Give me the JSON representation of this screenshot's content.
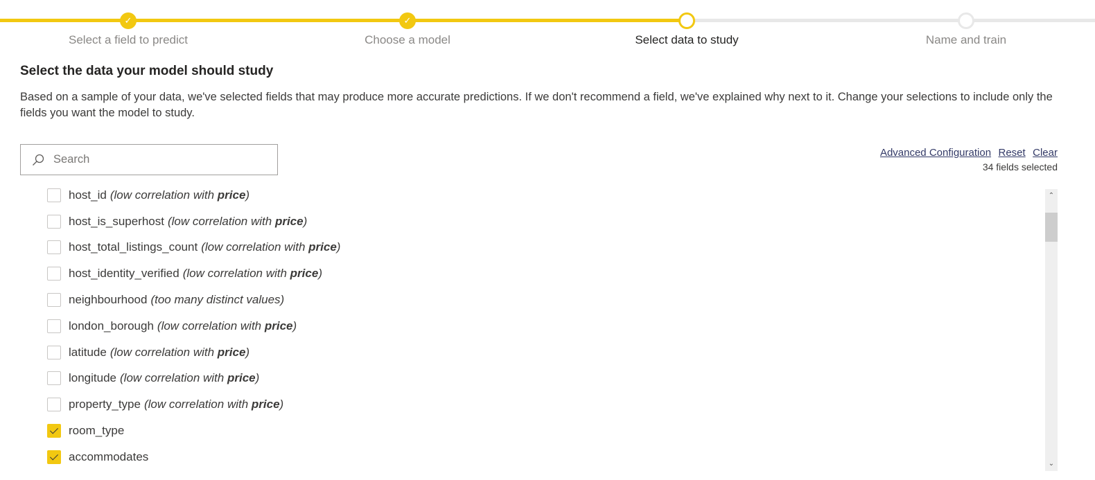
{
  "stepper": {
    "steps": [
      {
        "label": "Select a field to predict",
        "state": "done"
      },
      {
        "label": "Choose a model",
        "state": "done"
      },
      {
        "label": "Select data to study",
        "state": "current"
      },
      {
        "label": "Name and train",
        "state": "todo"
      }
    ],
    "check_glyph": "✓"
  },
  "colors": {
    "accent": "#F2C811",
    "track_inactive": "#E8E8E8",
    "link": "#333A67"
  },
  "page": {
    "title": "Select the data your model should study",
    "description": "Based on a sample of your data, we've selected fields that may produce more accurate predictions. If we don't recommend a field, we've explained why next to it. Change your selections to include only the fields you want the model to study."
  },
  "search": {
    "placeholder": "Search",
    "value": ""
  },
  "actions": {
    "advanced_label": "Advanced Configuration",
    "reset_label": "Reset",
    "clear_label": "Clear",
    "selected_count": "34 fields selected"
  },
  "fields": [
    {
      "name": "host_id",
      "checked": false,
      "reason_prefix": "(low correlation with ",
      "reason_bold": "price",
      "reason_suffix": ")"
    },
    {
      "name": "host_is_superhost",
      "checked": false,
      "reason_prefix": "(low correlation with ",
      "reason_bold": "price",
      "reason_suffix": ")"
    },
    {
      "name": "host_total_listings_count",
      "checked": false,
      "reason_prefix": "(low correlation with ",
      "reason_bold": "price",
      "reason_suffix": ")"
    },
    {
      "name": "host_identity_verified",
      "checked": false,
      "reason_prefix": "(low correlation with ",
      "reason_bold": "price",
      "reason_suffix": ")"
    },
    {
      "name": "neighbourhood",
      "checked": false,
      "reason_prefix": "(too many distinct values)",
      "reason_bold": "",
      "reason_suffix": ""
    },
    {
      "name": "london_borough",
      "checked": false,
      "reason_prefix": "(low correlation with ",
      "reason_bold": "price",
      "reason_suffix": ")"
    },
    {
      "name": "latitude",
      "checked": false,
      "reason_prefix": "(low correlation with ",
      "reason_bold": "price",
      "reason_suffix": ")"
    },
    {
      "name": "longitude",
      "checked": false,
      "reason_prefix": "(low correlation with ",
      "reason_bold": "price",
      "reason_suffix": ")"
    },
    {
      "name": "property_type",
      "checked": false,
      "reason_prefix": "(low correlation with ",
      "reason_bold": "price",
      "reason_suffix": ")"
    },
    {
      "name": "room_type",
      "checked": true,
      "reason_prefix": "",
      "reason_bold": "",
      "reason_suffix": ""
    },
    {
      "name": "accommodates",
      "checked": true,
      "reason_prefix": "",
      "reason_bold": "",
      "reason_suffix": ""
    }
  ],
  "scrollbar": {
    "up_glyph": "⌃",
    "down_glyph": "⌄"
  }
}
